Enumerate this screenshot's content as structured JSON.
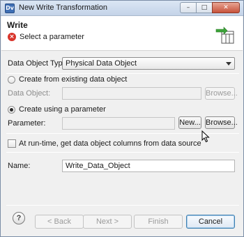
{
  "window": {
    "app_icon": "Dv",
    "title": "New Write Transformation",
    "controls": {
      "minimize_icon": "minimize-icon",
      "maximize_icon": "maximize-icon",
      "close_icon": "close-icon"
    }
  },
  "header": {
    "title": "Write",
    "message": "Select a parameter",
    "message_icon": "error-icon",
    "wizard_icon": "write-transformation-wizard-icon"
  },
  "form": {
    "data_object_type": {
      "label": "Data Object Type:",
      "selected": "Physical Data Object"
    },
    "option_existing": {
      "label": "Create from existing data object",
      "checked": false
    },
    "data_object": {
      "label": "Data Object:",
      "value": "",
      "browse_label": "Browse...",
      "enabled": false
    },
    "option_parameter": {
      "label": "Create using a parameter",
      "checked": true
    },
    "parameter": {
      "label": "Parameter:",
      "value": "",
      "new_label": "New...",
      "browse_label": "Browse..."
    },
    "runtime_checkbox": {
      "label": "At run-time, get data object columns from data source",
      "checked": false
    },
    "name": {
      "label": "Name:",
      "value": "Write_Data_Object"
    }
  },
  "footer": {
    "help_label": "?",
    "back_label": "< Back",
    "next_label": "Next >",
    "finish_label": "Finish",
    "cancel_label": "Cancel"
  }
}
